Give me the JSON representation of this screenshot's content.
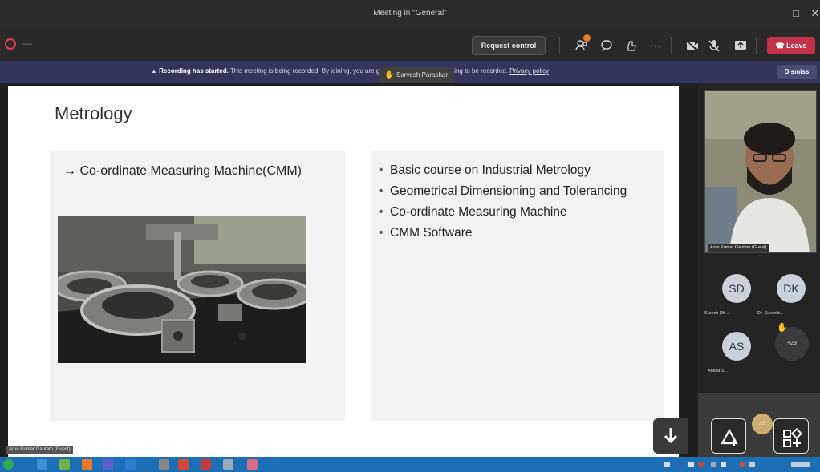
{
  "window": {
    "title": "Meeting in \"General\"",
    "controls": [
      "–",
      "□",
      "✕"
    ]
  },
  "toolbar": {
    "request_control_label": "Request control",
    "leave_label": "Leave",
    "icons": [
      "people-icon",
      "chat-icon",
      "reactions-icon",
      "more-icon",
      "camera-icon",
      "mic-icon",
      "share-icon"
    ]
  },
  "banner": {
    "bold": "Recording has started.",
    "text": "This meeting is being recorded. By joining, you are giving consent for this meeting to be recorded.",
    "link": "Privacy policy",
    "dismiss_label": "Dismiss"
  },
  "hand_raise_tooltip": {
    "name": "Sarvesh Parashar"
  },
  "slide": {
    "title": "Metrology",
    "left_heading": "→ Co-ordinate Measuring Machine(CMM)",
    "bullets": [
      "Basic course on Industrial Metrology",
      "Geometrical Dimensioning and Tolerancing",
      "Co-ordinate Measuring Machine",
      "CMM Software"
    ]
  },
  "presenter_tag": "Arun Kumar Gautam (Guest)",
  "participants": {
    "camera_name": "Arun Kumar Gautam (Guest)",
    "avatars": [
      {
        "initials": "SD",
        "label": "Suresh Dh..."
      },
      {
        "initials": "DK",
        "label": "Dr. Surendr..."
      },
      {
        "initials": "AS",
        "label": "Ankita S..."
      }
    ],
    "more_label": "+29"
  },
  "floating": {
    "cursor_label": "AS"
  },
  "colors": {
    "leave": "#c4314b",
    "banner": "#33355a",
    "taskbar": "#1c6fb5",
    "hand": "#f5b301"
  }
}
